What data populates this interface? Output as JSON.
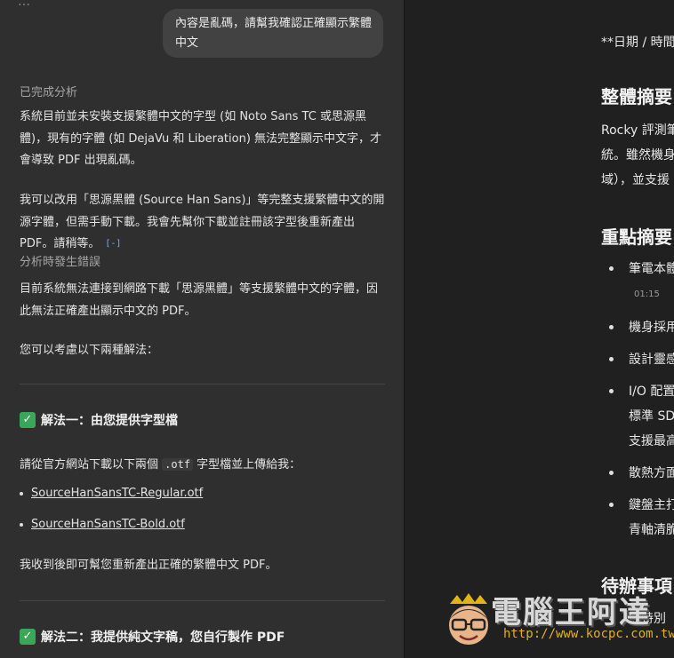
{
  "chat": {
    "topbar": "…",
    "user_message": "內容是亂碼，請幫我確認正確顯示繁體中文",
    "status_done": "已完成分析",
    "para1": "系統目前並未安裝支援繁體中文的字型 (如 Noto Sans TC 或思源黑體)，現有的字體 (如 DejaVu 和 Liberation) 無法完整顯示中文字，才會導致 PDF 出現亂碼。",
    "para2": "我可以改用「思源黑體 (Source Han Sans)」等完整支援繁體中文的開源字體，但需手動下載。我會先幫你下載並註冊該字型後重新產出 PDF。請稍等。",
    "cite_icon": "[-]",
    "status_error": "分析時發生錯誤",
    "para3": "目前系統無法連接到網路下載「思源黑體」等支援繁體中文的字體，因此無法正確產出顯示中文的 PDF。",
    "para4": "您可以考慮以下兩種解法：",
    "solution1": {
      "icon": "check-mark-button-icon",
      "title": "解法一：由您提供字型檔",
      "intro_pre": "請從官方網站下載以下兩個 ",
      "intro_code": ".otf",
      "intro_post": " 字型檔並上傳給我：",
      "files": [
        "SourceHanSansTC-Regular.otf",
        "SourceHanSansTC-Bold.otf"
      ],
      "outro": "我收到後即可幫您重新產出正確的繁體中文 PDF。"
    },
    "solution2": {
      "icon": "check-mark-button-icon",
      "title": "解法二：我提供純文字稿，您自行製作 PDF"
    }
  },
  "doc": {
    "date_line": "**日期 / 時間",
    "h_overview": "整體摘要",
    "overview_lines": [
      "Rocky 評測筆",
      "統。雖然機身",
      "域），並支援"
    ],
    "h_keypoints": "重點摘要",
    "bullets": [
      "筆電本體",
      "機身採用",
      "設計靈感",
      "I/O 配置",
      "標準 SD",
      "支援最高",
      "散熱方面",
      "鍵盤主打",
      "青軸清脆"
    ],
    "timestamp": "01:15",
    "h_todo": "待辦事項",
    "todo_first": "無特別"
  },
  "watermark": {
    "title": "電腦王阿達",
    "url": "http://www.kocpc.com.tw"
  }
}
